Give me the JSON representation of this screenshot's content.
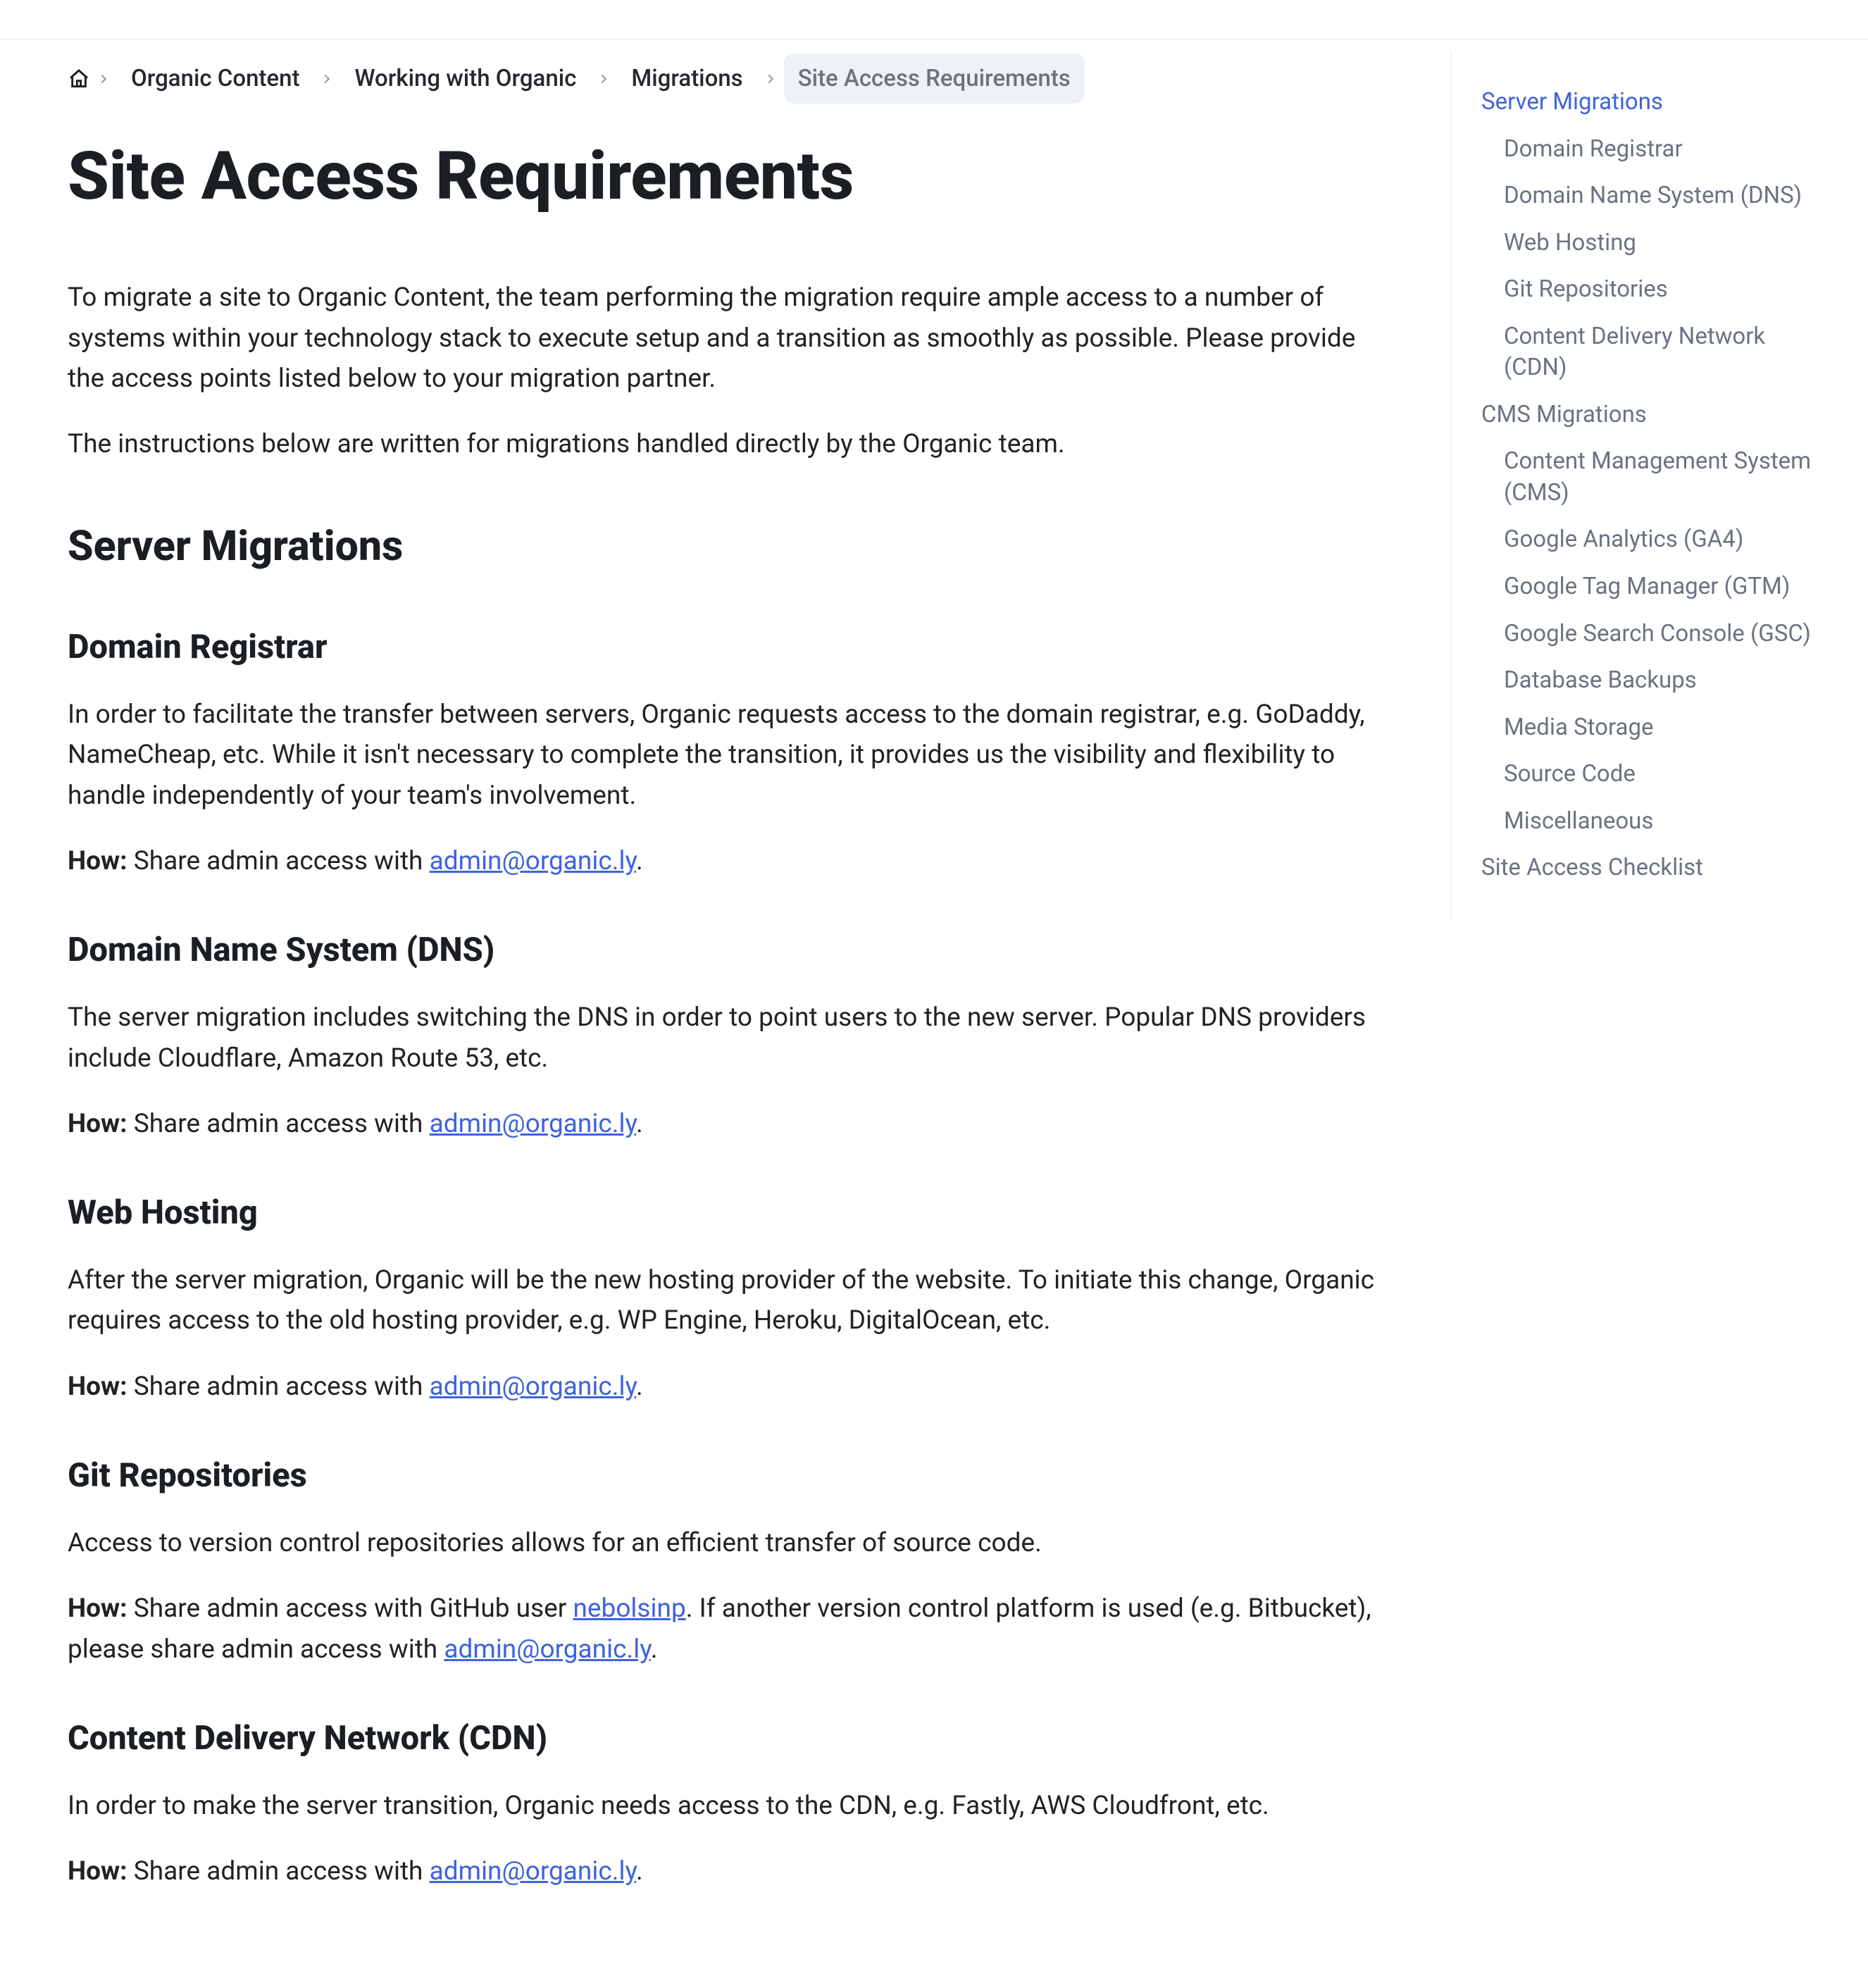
{
  "breadcrumb": {
    "items": [
      {
        "label": "Organic Content"
      },
      {
        "label": "Working with Organic"
      },
      {
        "label": "Migrations"
      },
      {
        "label": "Site Access Requirements",
        "current": true
      }
    ]
  },
  "title": "Site Access Requirements",
  "intro1": "To migrate a site to Organic Content, the team performing the migration require ample access to a number of systems within your technology stack to execute setup and a transition as smoothly as possible. Please provide the access points listed below to your migration partner.",
  "intro2": "The instructions below are written for migrations handled directly by the Organic team.",
  "accessEmail": "admin@organic.ly",
  "githubUser": "nebolsinp",
  "howLabel": "How:",
  "shareAdminPrefix": " Share admin access with ",
  "shareGithubPrefix": " Share admin access with GitHub user ",
  "gitSuffix1": ". If another version control platform is used (e.g. Bitbucket), please share admin access with ",
  "period": ".",
  "sections": {
    "serverMigrations": {
      "heading": "Server Migrations",
      "domainRegistrar": {
        "heading": "Domain Registrar",
        "body": "In order to facilitate the transfer between servers, Organic requests access to the domain registrar, e.g. GoDaddy, NameCheap, etc. While it isn't necessary to complete the transition, it provides us the visibility and flexibility to handle independently of your team's involvement."
      },
      "dns": {
        "heading": "Domain Name System (DNS)",
        "body": "The server migration includes switching the DNS in order to point users to the new server. Popular DNS providers include Cloudflare, Amazon Route 53, etc."
      },
      "webHosting": {
        "heading": "Web Hosting",
        "body": "After the server migration, Organic will be the new hosting provider of the website. To initiate this change, Organic requires access to the old hosting provider, e.g. WP Engine, Heroku, DigitalOcean, etc."
      },
      "git": {
        "heading": "Git Repositories",
        "body": "Access to version control repositories allows for an efficient transfer of source code."
      },
      "cdn": {
        "heading": "Content Delivery Network (CDN)",
        "body": "In order to make the server transition, Organic needs access to the CDN, e.g. Fastly, AWS Cloudfront, etc."
      }
    }
  },
  "toc": {
    "items": [
      {
        "label": "Server Migrations",
        "level": 0,
        "active": true
      },
      {
        "label": "Domain Registrar",
        "level": 1
      },
      {
        "label": "Domain Name System (DNS)",
        "level": 1
      },
      {
        "label": "Web Hosting",
        "level": 1
      },
      {
        "label": "Git Repositories",
        "level": 1
      },
      {
        "label": "Content Delivery Network (CDN)",
        "level": 1
      },
      {
        "label": "CMS Migrations",
        "level": 0
      },
      {
        "label": "Content Management System (CMS)",
        "level": 1
      },
      {
        "label": "Google Analytics (GA4)",
        "level": 1
      },
      {
        "label": "Google Tag Manager (GTM)",
        "level": 1
      },
      {
        "label": "Google Search Console (GSC)",
        "level": 1
      },
      {
        "label": "Database Backups",
        "level": 1
      },
      {
        "label": "Media Storage",
        "level": 1
      },
      {
        "label": "Source Code",
        "level": 1
      },
      {
        "label": "Miscellaneous",
        "level": 1
      },
      {
        "label": "Site Access Checklist",
        "level": 0
      }
    ]
  }
}
